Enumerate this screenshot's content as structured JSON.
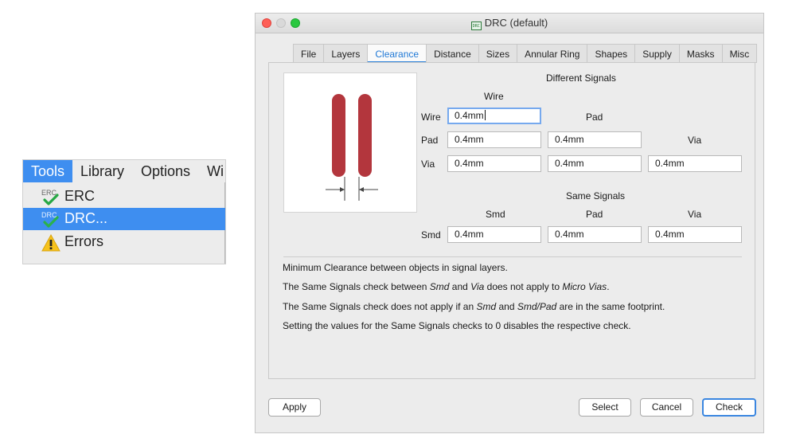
{
  "menu": {
    "bar": [
      "Tools",
      "Library",
      "Options",
      "Wi"
    ],
    "items": [
      {
        "label": "ERC",
        "icon": "erc-check-icon",
        "icon_text": "ERC"
      },
      {
        "label": "DRC...",
        "icon": "drc-check-icon",
        "icon_text": "DRC"
      },
      {
        "label": "Errors",
        "icon": "warning-icon"
      }
    ],
    "selected_index": 1
  },
  "window": {
    "title": "DRC (default)",
    "title_icon_text": "DRC"
  },
  "tabs": [
    "File",
    "Layers",
    "Clearance",
    "Distance",
    "Sizes",
    "Annular Ring",
    "Shapes",
    "Supply",
    "Masks",
    "Misc"
  ],
  "active_tab": "Clearance",
  "clearance": {
    "different_signals_title": "Different Signals",
    "col_wire": "Wire",
    "col_pad": "Pad",
    "col_via": "Via",
    "row_wire": "Wire",
    "row_pad": "Pad",
    "row_via": "Via",
    "wire_wire": "0.4mm",
    "pad_wire": "0.4mm",
    "pad_pad": "0.4mm",
    "via_wire": "0.4mm",
    "via_pad": "0.4mm",
    "via_via": "0.4mm",
    "same_signals_title": "Same Signals",
    "same_col_smd": "Smd",
    "same_col_pad": "Pad",
    "same_col_via": "Via",
    "same_row_smd": "Smd",
    "smd_smd": "0.4mm",
    "smd_pad": "0.4mm",
    "smd_via": "0.4mm"
  },
  "notes": {
    "line1": "Minimum Clearance between objects in signal layers.",
    "line2_a": "The Same Signals check between ",
    "line2_b": "Smd",
    "line2_c": " and ",
    "line2_d": "Via",
    "line2_e": " does not apply to ",
    "line2_f": "Micro Vias",
    "line2_g": ".",
    "line3_a": "The Same Signals check does not apply if an ",
    "line3_b": "Smd",
    "line3_c": " and ",
    "line3_d": "Smd/Pad",
    "line3_e": " are in the same footprint.",
    "line4": "Setting the values for the Same Signals checks to 0 disables the respective check."
  },
  "buttons": {
    "apply": "Apply",
    "select": "Select",
    "cancel": "Cancel",
    "check": "Check"
  },
  "colors": {
    "accent": "#3e8ef0",
    "trace": "#b3363d",
    "active_tab_text": "#1f78d6"
  }
}
